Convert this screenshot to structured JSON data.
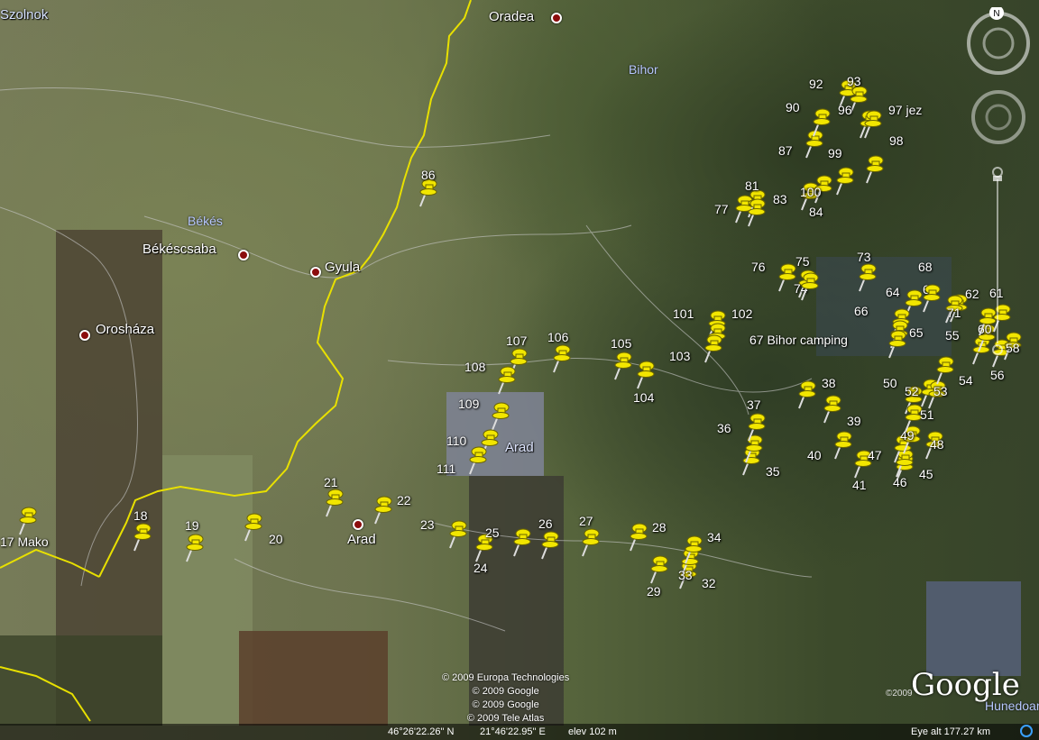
{
  "labels": {
    "cities": [
      {
        "name": "Szolnok"
      },
      {
        "name": "Oradea"
      },
      {
        "name": "Békéscsaba"
      },
      {
        "name": "Gyula"
      },
      {
        "name": "Orosháza"
      },
      {
        "name": "Arad"
      },
      {
        "name": "Arad"
      }
    ],
    "regions": [
      {
        "name": "Bihor"
      },
      {
        "name": "Békés"
      },
      {
        "name": "Hunedoar"
      }
    ]
  },
  "pins": [
    {
      "label": "17 Mako"
    },
    {
      "label": "18"
    },
    {
      "label": "19"
    },
    {
      "label": "20"
    },
    {
      "label": "21"
    },
    {
      "label": "22"
    },
    {
      "label": "23"
    },
    {
      "label": "24"
    },
    {
      "label": "25"
    },
    {
      "label": "26"
    },
    {
      "label": "27"
    },
    {
      "label": "28"
    },
    {
      "label": "29"
    },
    {
      "label": "32"
    },
    {
      "label": "33"
    },
    {
      "label": "34"
    },
    {
      "label": "35"
    },
    {
      "label": "36"
    },
    {
      "label": "37"
    },
    {
      "label": "38"
    },
    {
      "label": "39"
    },
    {
      "label": "40"
    },
    {
      "label": "41"
    },
    {
      "label": "45"
    },
    {
      "label": "46"
    },
    {
      "label": "47"
    },
    {
      "label": "48"
    },
    {
      "label": "49"
    },
    {
      "label": "50"
    },
    {
      "label": "51"
    },
    {
      "label": "52"
    },
    {
      "label": "53"
    },
    {
      "label": "54"
    },
    {
      "label": "55"
    },
    {
      "label": "56"
    },
    {
      "label": "58"
    },
    {
      "label": "60"
    },
    {
      "label": "61"
    },
    {
      "label": "62"
    },
    {
      "label": "63"
    },
    {
      "label": "64"
    },
    {
      "label": "65"
    },
    {
      "label": "66"
    },
    {
      "label": "67 Bihor camping"
    },
    {
      "label": "68"
    },
    {
      "label": "71"
    },
    {
      "label": "73"
    },
    {
      "label": "74"
    },
    {
      "label": "75"
    },
    {
      "label": "76"
    },
    {
      "label": "77"
    },
    {
      "label": "81"
    },
    {
      "label": "83"
    },
    {
      "label": "84"
    },
    {
      "label": "86"
    },
    {
      "label": "87"
    },
    {
      "label": "90"
    },
    {
      "label": "92"
    },
    {
      "label": "93"
    },
    {
      "label": "96"
    },
    {
      "label": "97 jez"
    },
    {
      "label": "98"
    },
    {
      "label": "99"
    },
    {
      "label": "100"
    },
    {
      "label": "101"
    },
    {
      "label": "102"
    },
    {
      "label": "103"
    },
    {
      "label": "104"
    },
    {
      "label": "105"
    },
    {
      "label": "106"
    },
    {
      "label": "107"
    },
    {
      "label": "108"
    },
    {
      "label": "109"
    },
    {
      "label": "110"
    },
    {
      "label": "111"
    }
  ],
  "credits": [
    "© 2009 Europa Technologies",
    "© 2009 Google",
    "© 2009 Google",
    "© 2009 Tele Atlas"
  ],
  "status": {
    "lat": "46°26'22.26\" N",
    "lon": "21°46'22.95\" E",
    "elev": "elev  102 m",
    "eye_alt": "Eye alt   177.27 km"
  },
  "google_logo": "Google",
  "google_year": "©2009",
  "compass_letter": "N",
  "colors": {
    "border": "#e8e000",
    "pin": "#f2e600",
    "city_dot": "#8b0d0d",
    "road": "#c9c9c9"
  }
}
